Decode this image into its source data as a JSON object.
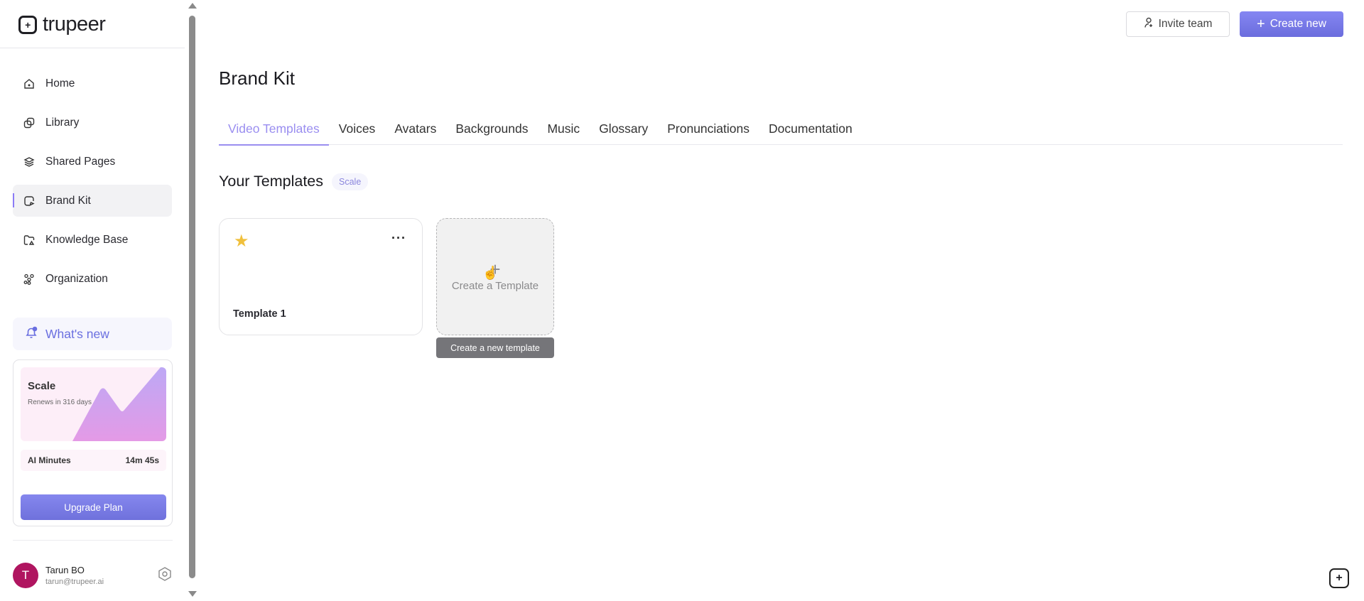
{
  "app": {
    "brand": "trupeer"
  },
  "sidebar": {
    "items": [
      {
        "label": "Home",
        "icon": "home-icon"
      },
      {
        "label": "Library",
        "icon": "library-icon"
      },
      {
        "label": "Shared Pages",
        "icon": "layers-icon"
      },
      {
        "label": "Brand Kit",
        "icon": "brand-kit-icon",
        "active": true
      },
      {
        "label": "Knowledge Base",
        "icon": "folder-icon"
      },
      {
        "label": "Organization",
        "icon": "organization-icon"
      }
    ],
    "whats_new": "What's new",
    "plan": {
      "name": "Scale",
      "renews": "Renews in 316 days",
      "minutes_label": "AI Minutes",
      "minutes_value": "14m 45s",
      "upgrade": "Upgrade Plan"
    },
    "user": {
      "initial": "T",
      "name": "Tarun BO",
      "email": "tarun@trupeer.ai"
    }
  },
  "header": {
    "invite": "Invite team",
    "create": "Create new"
  },
  "main": {
    "title": "Brand Kit",
    "tabs": [
      {
        "label": "Video Templates",
        "active": true
      },
      {
        "label": "Voices"
      },
      {
        "label": "Avatars"
      },
      {
        "label": "Backgrounds"
      },
      {
        "label": "Music"
      },
      {
        "label": "Glossary"
      },
      {
        "label": "Pronunciations"
      },
      {
        "label": "Documentation"
      }
    ],
    "section_title": "Your Templates",
    "section_badge": "Scale",
    "templates": [
      {
        "name": "Template 1",
        "starred": true
      }
    ],
    "create_card": {
      "plus": "+",
      "label": "Create a Template"
    },
    "tooltip": "Create a new template"
  },
  "colors": {
    "accent": "#8b7cf6",
    "primary_button": "#7576e6",
    "avatar": "#b01560",
    "star": "#f0c03c"
  }
}
